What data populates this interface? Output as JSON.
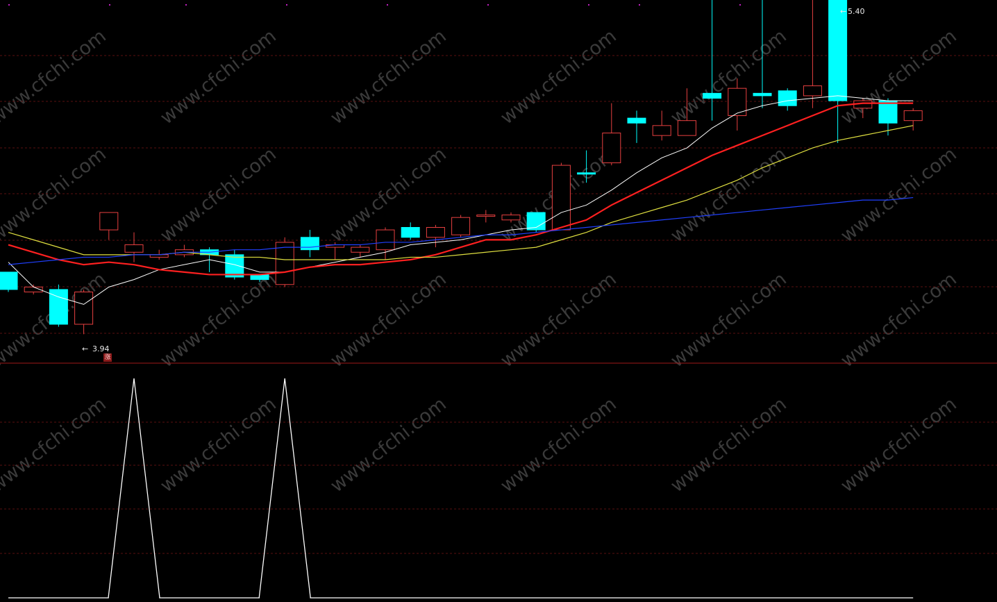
{
  "chart_data": [
    {
      "type": "candlestick",
      "title": "",
      "price_range": [
        3.5,
        5.5
      ],
      "grid": true,
      "annotations": {
        "low_label": "3.94",
        "high_label": "5.40"
      },
      "candles": [
        {
          "open": 4.19,
          "close": 4.12,
          "high": 4.17,
          "low": 4.11,
          "dir": "down"
        },
        {
          "open": 4.11,
          "close": 4.13,
          "high": 4.14,
          "low": 4.1,
          "dir": "up"
        },
        {
          "open": 4.12,
          "close": 3.98,
          "high": 4.14,
          "low": 3.97,
          "dir": "down"
        },
        {
          "open": 3.98,
          "close": 4.11,
          "high": 4.12,
          "low": 3.94,
          "dir": "up"
        },
        {
          "open": 4.36,
          "close": 4.43,
          "high": 4.43,
          "low": 4.32,
          "dir": "up"
        },
        {
          "open": 4.27,
          "close": 4.3,
          "high": 4.35,
          "low": 4.23,
          "dir": "up"
        },
        {
          "open": 4.25,
          "close": 4.26,
          "high": 4.28,
          "low": 4.24,
          "dir": "up"
        },
        {
          "open": 4.26,
          "close": 4.28,
          "high": 4.3,
          "low": 4.25,
          "dir": "up"
        },
        {
          "open": 4.28,
          "close": 4.26,
          "high": 4.29,
          "low": 4.19,
          "dir": "down"
        },
        {
          "open": 4.26,
          "close": 4.17,
          "high": 4.28,
          "low": 4.16,
          "dir": "down"
        },
        {
          "open": 4.18,
          "close": 4.16,
          "high": 4.18,
          "low": 4.15,
          "dir": "down"
        },
        {
          "open": 4.14,
          "close": 4.31,
          "high": 4.33,
          "low": 4.13,
          "dir": "up"
        },
        {
          "open": 4.33,
          "close": 4.28,
          "high": 4.36,
          "low": 4.25,
          "dir": "down"
        },
        {
          "open": 4.29,
          "close": 4.3,
          "high": 4.31,
          "low": 4.24,
          "dir": "up"
        },
        {
          "open": 4.27,
          "close": 4.29,
          "high": 4.3,
          "low": 4.25,
          "dir": "up"
        },
        {
          "open": 4.28,
          "close": 4.36,
          "high": 4.37,
          "low": 4.24,
          "dir": "up"
        },
        {
          "open": 4.37,
          "close": 4.33,
          "high": 4.39,
          "low": 4.32,
          "dir": "down"
        },
        {
          "open": 4.33,
          "close": 4.37,
          "high": 4.38,
          "low": 4.29,
          "dir": "up"
        },
        {
          "open": 4.34,
          "close": 4.41,
          "high": 4.42,
          "low": 4.33,
          "dir": "up"
        },
        {
          "open": 4.42,
          "close": 4.42,
          "high": 4.44,
          "low": 4.39,
          "dir": "up"
        },
        {
          "open": 4.4,
          "close": 4.42,
          "high": 4.43,
          "low": 4.39,
          "dir": "up"
        },
        {
          "open": 4.43,
          "close": 4.36,
          "high": 4.43,
          "low": 4.35,
          "dir": "down"
        },
        {
          "open": 4.36,
          "close": 4.62,
          "high": 4.63,
          "low": 4.36,
          "dir": "up"
        },
        {
          "open": 4.59,
          "close": 4.59,
          "high": 4.68,
          "low": 4.55,
          "dir": "down"
        },
        {
          "open": 4.63,
          "close": 4.75,
          "high": 4.87,
          "low": 4.62,
          "dir": "up"
        },
        {
          "open": 4.81,
          "close": 4.79,
          "high": 4.84,
          "low": 4.71,
          "dir": "down"
        },
        {
          "open": 4.74,
          "close": 4.78,
          "high": 4.84,
          "low": 4.72,
          "dir": "up"
        },
        {
          "open": 4.74,
          "close": 4.8,
          "high": 4.93,
          "low": 4.74,
          "dir": "up"
        },
        {
          "open": 4.91,
          "close": 4.89,
          "high": 5.35,
          "low": 4.8,
          "dir": "down"
        },
        {
          "open": 4.82,
          "close": 4.93,
          "high": 4.97,
          "low": 4.76,
          "dir": "up"
        },
        {
          "open": 4.91,
          "close": 4.9,
          "high": 5.3,
          "low": 4.85,
          "dir": "down"
        },
        {
          "open": 4.92,
          "close": 4.86,
          "high": 4.93,
          "low": 4.84,
          "dir": "down"
        },
        {
          "open": 4.9,
          "close": 4.94,
          "high": 5.35,
          "low": 4.85,
          "dir": "up"
        },
        {
          "open": 5.4,
          "close": 4.88,
          "high": 5.4,
          "low": 4.71,
          "dir": "down"
        },
        {
          "open": 4.85,
          "close": 4.88,
          "high": 4.89,
          "low": 4.81,
          "dir": "up"
        },
        {
          "open": 4.88,
          "close": 4.79,
          "high": 4.89,
          "low": 4.74,
          "dir": "down"
        },
        {
          "open": 4.8,
          "close": 4.84,
          "high": 4.85,
          "low": 4.76,
          "dir": "up"
        }
      ],
      "series": [
        {
          "color": "#ffffff",
          "values": [
            4.23,
            4.13,
            4.09,
            4.06,
            4.13,
            4.16,
            4.2,
            4.22,
            4.24,
            4.22,
            4.19,
            4.19,
            4.21,
            4.23,
            4.25,
            4.27,
            4.3,
            4.31,
            4.32,
            4.34,
            4.36,
            4.37,
            4.43,
            4.46,
            4.52,
            4.59,
            4.65,
            4.69,
            4.77,
            4.83,
            4.86,
            4.88,
            4.89,
            4.9,
            4.89,
            4.88,
            4.88
          ]
        },
        {
          "color": "#ff2020",
          "values": [
            4.3,
            4.27,
            4.24,
            4.22,
            4.23,
            4.22,
            4.2,
            4.19,
            4.18,
            4.18,
            4.18,
            4.19,
            4.21,
            4.22,
            4.22,
            4.23,
            4.24,
            4.26,
            4.29,
            4.32,
            4.32,
            4.34,
            4.37,
            4.4,
            4.46,
            4.51,
            4.56,
            4.61,
            4.66,
            4.7,
            4.74,
            4.78,
            4.82,
            4.86,
            4.87,
            4.87,
            4.87
          ]
        },
        {
          "color": "#e0e040",
          "values": [
            4.35,
            4.32,
            4.29,
            4.26,
            4.26,
            4.26,
            4.26,
            4.27,
            4.26,
            4.25,
            4.25,
            4.24,
            4.24,
            4.24,
            4.24,
            4.24,
            4.25,
            4.25,
            4.26,
            4.27,
            4.28,
            4.29,
            4.32,
            4.35,
            4.39,
            4.42,
            4.45,
            4.48,
            4.52,
            4.56,
            4.61,
            4.65,
            4.69,
            4.72,
            4.74,
            4.76,
            4.78
          ]
        },
        {
          "color": "#2040ff",
          "values": [
            4.22,
            4.23,
            4.24,
            4.25,
            4.25,
            4.26,
            4.26,
            4.27,
            4.27,
            4.28,
            4.28,
            4.29,
            4.29,
            4.3,
            4.3,
            4.31,
            4.31,
            4.32,
            4.33,
            4.34,
            4.34,
            4.35,
            4.36,
            4.37,
            4.38,
            4.39,
            4.4,
            4.41,
            4.42,
            4.43,
            4.44,
            4.45,
            4.46,
            4.47,
            4.48,
            4.48,
            4.49
          ]
        }
      ]
    },
    {
      "type": "line",
      "title": "",
      "ylim": [
        0,
        1
      ],
      "series": [
        {
          "color": "#ffffff",
          "values": [
            0,
            0,
            0,
            0,
            0,
            1,
            0,
            0,
            0,
            0,
            0,
            1,
            0,
            0,
            0,
            0,
            0,
            0,
            0,
            0,
            0,
            0,
            0,
            0,
            0,
            0,
            0,
            0,
            0,
            0,
            0,
            0,
            0,
            0,
            0,
            0,
            0
          ]
        }
      ]
    }
  ],
  "badge": {
    "text": "涨"
  },
  "watermark": {
    "text": "www.cfchi.com"
  }
}
